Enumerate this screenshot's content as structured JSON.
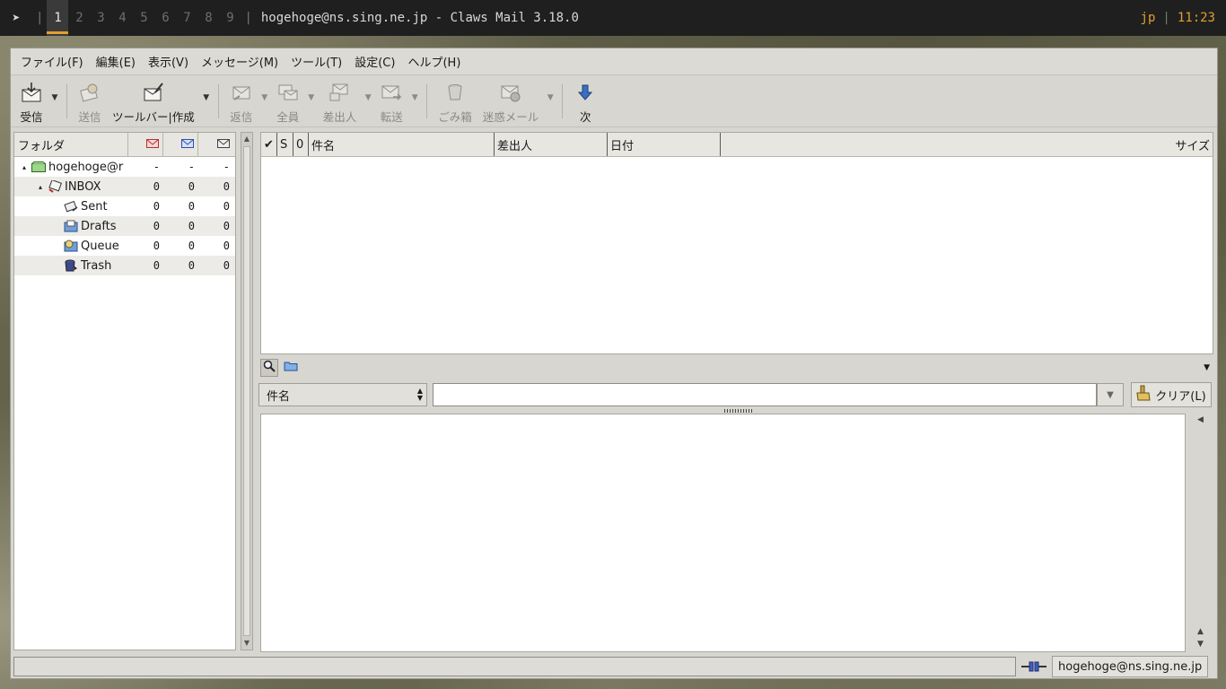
{
  "topbar": {
    "workspaces": [
      "1",
      "2",
      "3",
      "4",
      "5",
      "6",
      "7",
      "8",
      "9"
    ],
    "active_workspace": "1",
    "window_title": "hogehoge@ns.sing.ne.jp - Claws Mail 3.18.0",
    "keyboard_layout": "jp",
    "clock": "11:23",
    "accent_color": "#e0a030"
  },
  "menubar": {
    "items": [
      "ファイル(F)",
      "編集(E)",
      "表示(V)",
      "メッセージ(M)",
      "ツール(T)",
      "設定(C)",
      "ヘルプ(H)"
    ]
  },
  "toolbar": {
    "receive": "受信",
    "send": "送信",
    "compose": "ツールバー|作成",
    "reply": "返信",
    "reply_all": "全員",
    "reply_sender": "差出人",
    "forward": "転送",
    "trash": "ごみ箱",
    "spam": "迷惑メール",
    "next": "次"
  },
  "folders": {
    "header": {
      "name": "フォルダ"
    },
    "rows": [
      {
        "name": "hogehoge@r",
        "new": "-",
        "unread": "-",
        "total": "-",
        "icon": "mailbox-icon",
        "expander": "▴"
      },
      {
        "name": "INBOX",
        "new": "0",
        "unread": "0",
        "total": "0",
        "icon": "inbox-icon",
        "expander": "▴"
      },
      {
        "name": "Sent",
        "new": "0",
        "unread": "0",
        "total": "0",
        "icon": "sent-icon"
      },
      {
        "name": "Drafts",
        "new": "0",
        "unread": "0",
        "total": "0",
        "icon": "drafts-icon"
      },
      {
        "name": "Queue",
        "new": "0",
        "unread": "0",
        "total": "0",
        "icon": "queue-icon"
      },
      {
        "name": "Trash",
        "new": "0",
        "unread": "0",
        "total": "0",
        "icon": "trash-icon"
      }
    ]
  },
  "messagelist": {
    "columns": {
      "check": "✔",
      "status": "S",
      "attach": "0",
      "subject": "件名",
      "from": "差出人",
      "date": "日付",
      "size": "サイズ"
    }
  },
  "quicksearch": {
    "type": "件名",
    "value": "",
    "clear": "クリア(L)"
  },
  "statusbar": {
    "message": "",
    "account": "hogehoge@ns.sing.ne.jp"
  }
}
